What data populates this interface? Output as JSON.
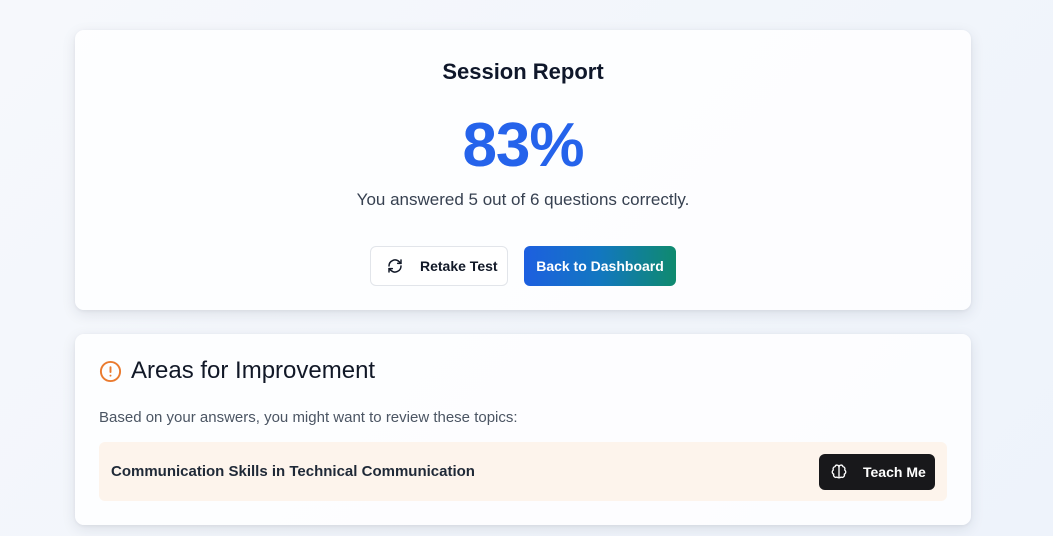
{
  "report": {
    "title": "Session Report",
    "score": "83%",
    "summary": "You answered 5 out of 6 questions correctly.",
    "retake_label": "Retake Test",
    "back_label": "Back to Dashboard",
    "score_color": "#2563eb"
  },
  "improvement": {
    "title": "Areas for Improvement",
    "description": "Based on your answers, you might want to review these topics:",
    "topics": [
      {
        "label": "Communication Skills in Technical Communication",
        "action_label": "Teach Me"
      }
    ],
    "warning_color": "#ea7a2e"
  },
  "icons": {
    "retake": "refresh-icon",
    "warning": "alert-circle-icon",
    "teach": "brain-icon"
  }
}
